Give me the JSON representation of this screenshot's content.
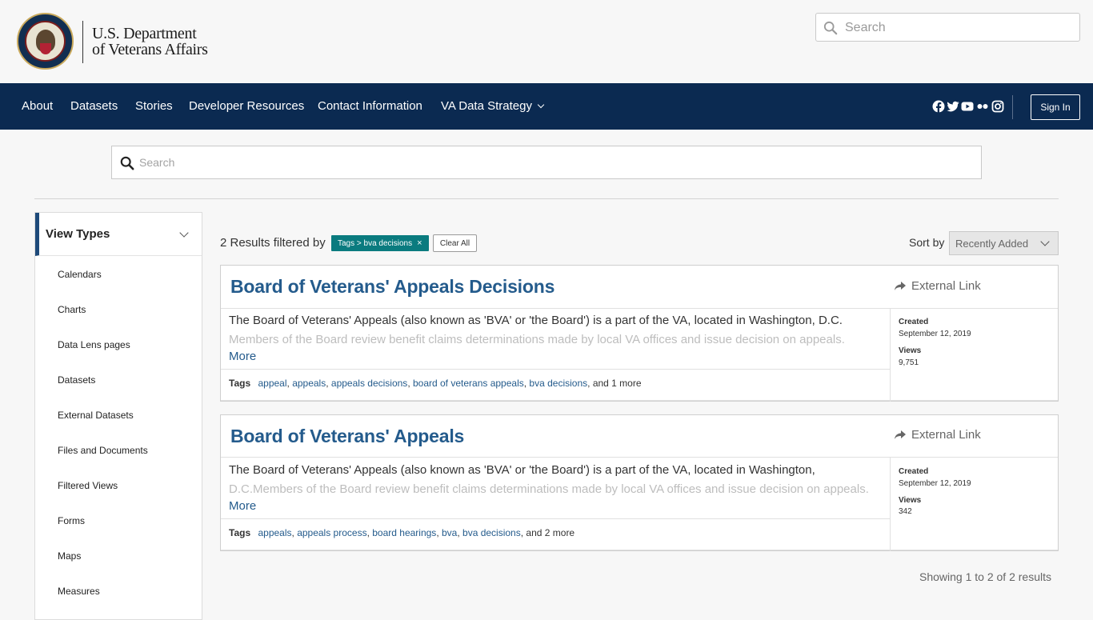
{
  "brand": {
    "line1": "U.S. Department",
    "line2": "of Veterans Affairs",
    "seal_icon": "va-seal-icon"
  },
  "header_search": {
    "placeholder": "Search"
  },
  "nav": {
    "items": [
      "About",
      "Datasets",
      "Stories",
      "Developer Resources",
      "Contact Information",
      "VA Data Strategy"
    ],
    "social_icons": [
      "facebook-icon",
      "twitter-icon",
      "youtube-icon",
      "flickr-icon",
      "instagram-icon"
    ],
    "signin": "Sign In",
    "bg_color": "#0b2a51"
  },
  "main_search": {
    "placeholder": "Search"
  },
  "sidebar": {
    "heading": "View Types",
    "items": [
      "Calendars",
      "Charts",
      "Data Lens pages",
      "Datasets",
      "External Datasets",
      "Files and Documents",
      "Filtered Views",
      "Forms",
      "Maps",
      "Measures"
    ]
  },
  "results_bar": {
    "count_text": "2 Results filtered by",
    "filter_chip": "Tags > bva decisions",
    "filter_chip_close": "×",
    "clear_all": "Clear All",
    "sort_label": "Sort by",
    "sort_value": "Recently Added",
    "chip_color": "#0a7b7f"
  },
  "results": [
    {
      "title": "Board of Veterans' Appeals Decisions",
      "link_type": "External Link",
      "desc_line1": "The Board of Veterans' Appeals (also known as 'BVA' or 'the Board') is a part of the VA, located in Washington, D.C.",
      "desc_line2": "Members of the Board review benefit claims determinations made by local VA offices and issue decision on appeals.",
      "more": "More",
      "tags_label": "Tags",
      "tags": [
        "appeal",
        "appeals",
        "appeals decisions",
        "board of veterans appeals",
        "bva decisions"
      ],
      "tags_more": "and 1 more",
      "created_label": "Created",
      "created": "September 12, 2019",
      "views_label": "Views",
      "views": "9,751"
    },
    {
      "title": "Board of Veterans' Appeals",
      "link_type": "External Link",
      "desc_line1": "The Board of Veterans' Appeals (also known as 'BVA' or 'the Board') is a part of the VA, located in Washington,",
      "desc_line2": "D.C.Members of the Board review benefit claims determinations made by local VA offices and issue decision on appeals.",
      "more": "More",
      "tags_label": "Tags",
      "tags": [
        "appeals",
        "appeals process",
        "board hearings",
        "bva",
        "bva decisions"
      ],
      "tags_more": "and 2 more",
      "created_label": "Created",
      "created": "September 12, 2019",
      "views_label": "Views",
      "views": "342"
    }
  ],
  "footer_text": "Showing 1 to 2 of 2 results",
  "accent_color": "#245b8c"
}
